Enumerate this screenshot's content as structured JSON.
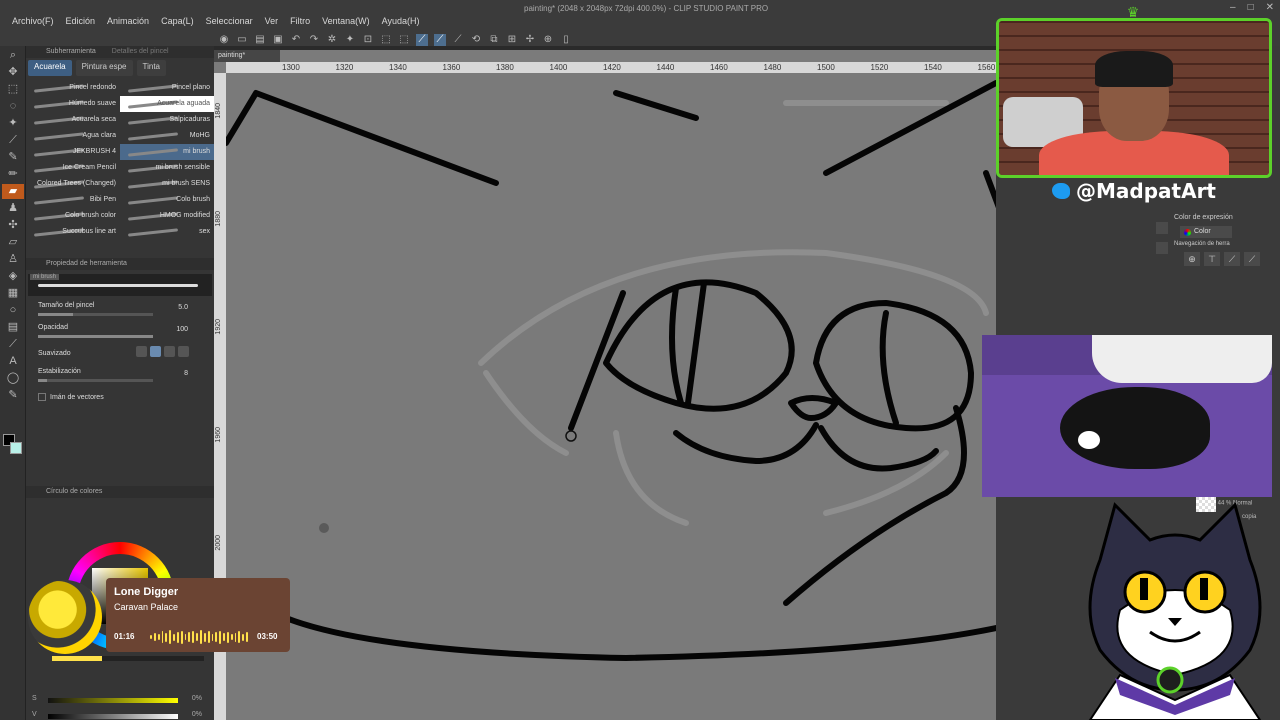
{
  "window": {
    "title": "painting* (2048 x 2048px 72dpi 400.0%) - CLIP STUDIO PAINT PRO"
  },
  "menu": [
    "Archivo(F)",
    "Edición",
    "Animación",
    "Capa(L)",
    "Seleccionar",
    "Ver",
    "Filtro",
    "Ventana(W)",
    "Ayuda(H)"
  ],
  "document_tab": "painting*",
  "subtool": {
    "panel_title": "Subherramienta",
    "panel_title_2": "Detalles del pincel",
    "tabs": [
      "Acuarela",
      "Pintura espe",
      "Tinta"
    ],
    "brushes": [
      [
        "Pincel redondo",
        "Pincel plano"
      ],
      [
        "Húmedo suave",
        "Acuarela aguada"
      ],
      [
        "Acuarela seca",
        "Salpicaduras"
      ],
      [
        "Agua clara",
        "MoHG"
      ],
      [
        "JEKBRUSH 4",
        "mi brush"
      ],
      [
        "Ice Cream Pencil",
        "mi brush sensible"
      ],
      [
        "Colored Trees (Changed)",
        "mi brush SENS"
      ],
      [
        "Bibi Pen",
        "Colo brush"
      ],
      [
        "Colo brush color",
        "HMOG modified"
      ],
      [
        "Succubus line art",
        "sex"
      ]
    ]
  },
  "tool_property": {
    "panel_title": "Propiedad de herramienta",
    "preview_label": "mi brush",
    "brush_size_label": "Tamaño del pincel",
    "brush_size_value": "5.0",
    "opacity_label": "Opacidad",
    "opacity_value": "100",
    "smoothing_label": "Suavizado",
    "stabilization_label": "Estabilización",
    "stabilization_value": "8",
    "vector_magnet_label": "Imán de vectores"
  },
  "color_panel": {
    "title": "Círculo de colores",
    "slider_1_label": "S",
    "slider_1_value": "0%",
    "slider_2_label": "V",
    "slider_2_value": "0%"
  },
  "rulers": {
    "top": [
      "1300",
      "1320",
      "1340",
      "1360",
      "1380",
      "1400",
      "1420",
      "1440",
      "1460",
      "1480",
      "1500",
      "1520",
      "1540",
      "1560",
      "158"
    ],
    "left": [
      "1840",
      "1880",
      "1920",
      "1960",
      "2000"
    ]
  },
  "navigator": {
    "expression_color_label": "Color de expresión",
    "color_mode": "Color",
    "nav_label": "Navegación de herra"
  },
  "layer": {
    "row_label": "44 % Normal",
    "row_label_2": "copia"
  },
  "stream": {
    "twitter_handle": "@MadpatArt"
  },
  "music": {
    "title": "Lone Digger",
    "artist": "Caravan Palace",
    "current_time": "01:16",
    "total_time": "03:50",
    "progress": 0.33
  },
  "colors": {
    "accent_green": "#5cd12a",
    "twitter_blue": "#1d9bf0",
    "music_card": "#6b4433",
    "music_yellow": "#ffe14a",
    "foreground_color": "#000000",
    "background_color": "#b9f0e8"
  }
}
